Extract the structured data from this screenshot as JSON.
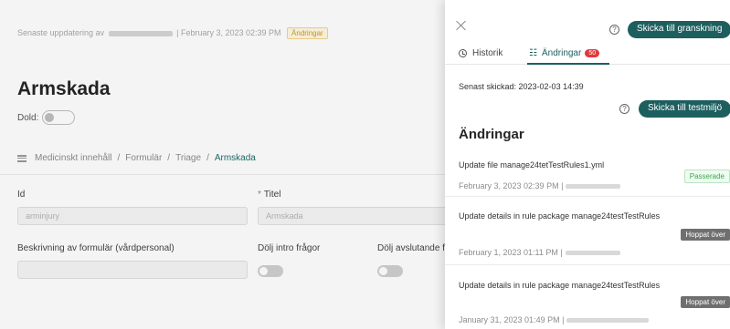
{
  "main": {
    "meta_prefix": "Senaste uppdatering av",
    "meta_date": "| February 3, 2023 02:39 PM",
    "meta_tag": "Ändringar",
    "title": "Armskada",
    "dold_label": "Dold:",
    "breadcrumb": [
      "Medicinskt innehåll",
      "Formulär",
      "Triage",
      "Armskada"
    ],
    "fields": {
      "id_label": "Id",
      "id_value": "arminjury",
      "titel_label": "Titel",
      "titel_value": "Armskada",
      "beskrivning_label": "Beskrivning av formulär (vårdpersonal)",
      "beskrivning_value": "",
      "dolj_intro_label": "Dölj intro frågor",
      "dolj_avslutande_label": "Dölj avslutande f"
    }
  },
  "drawer": {
    "send_review_label": "Skicka till granskning",
    "tabs": [
      {
        "label": "Historik"
      },
      {
        "label": "Ändringar",
        "badge": "50"
      }
    ],
    "last_sent": "Senast skickad: 2023-02-03 14:39",
    "send_test_label": "Skicka till testmiljö",
    "section_title": "Ändringar",
    "changes": [
      {
        "title": "Update file manage24tetTestRules1.yml",
        "date": "February 3, 2023 02:39 PM |",
        "status": "Passerade"
      },
      {
        "title": "Update details in rule package manage24testTestRules",
        "date": "February 1, 2023 01:11 PM |",
        "status": "Hoppat över"
      },
      {
        "title": "Update details in rule package manage24testTestRules",
        "date": "January 31, 2023 01:49 PM |",
        "status": "Hoppat över"
      }
    ]
  },
  "colors": {
    "primary": "#1d5f5e",
    "badge_red": "#e03a3a",
    "pass_green": "#3aa84a",
    "skip_gray": "#6f6f6f",
    "tag_yellow": "#d29a1b"
  }
}
